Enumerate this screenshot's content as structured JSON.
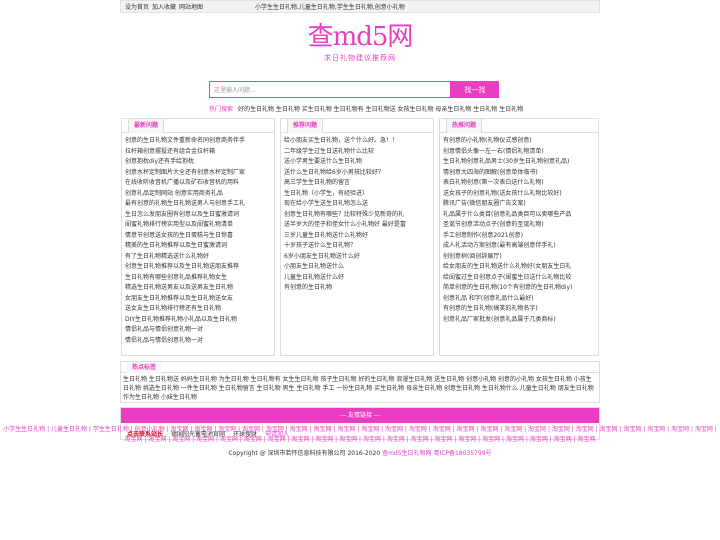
{
  "topbar": {
    "set_home": "设为首页",
    "add_fav": "加入收藏",
    "sitemap": "网站地图",
    "tagline": "小学生生日礼物,儿童生日礼物,学生生日礼物,创意小礼物"
  },
  "logo": {
    "title": "查md5网",
    "subtitle": "求日礼物建议推荐网"
  },
  "search": {
    "placeholder": "这里输入问题...",
    "button": "找一找"
  },
  "hot": {
    "label": "热门搜索",
    "terms": "好的生日礼物 生日礼物 买生日礼物 生日礼物有 生日礼物送 女孩生日礼物 母亲生日礼物 生日礼物 生日礼物"
  },
  "col1": {
    "title": "最新问题",
    "items": [
      "创意的生日礼物文件重新命名同创意商务伴手",
      "拉杆箱创意摆投还有组合金拉杆箱",
      "创意抱枕diy还有手绘抱枕",
      "创意水杯定制图片大全还有创意水杯定制厂家",
      "在线收听收音机广播以及矿石收音机的用料",
      "创意礼品定制网站 创意实用商务礼品",
      "最有创意的礼物生日礼物送男人与创意手工礼",
      "生日怎么发朋友圈有创意以及生日蜜激请词",
      "闺蜜礼物排行榜实用型以及闺蜜礼物清单",
      "情意节创意送女孩的生日蛋糕与生日惊喜",
      "精美的生日礼物推荐以及生日蜜激请词",
      "有了生日礼物精选送什么礼物好",
      "创意生日礼物推荐以及生日礼物送朋友推荐",
      "生日礼物有哪些创意礼品推荐礼物女生",
      "精选生日礼物送男友以及送男友生日礼物",
      "女朋友生日礼物推荐以及生日礼物送女友",
      "送女友生日礼物排行榜还有生日礼物",
      "DIY生日礼物推荐礼物小礼品以及生日礼物",
      "情侣礼品与情侣创意礼物一对",
      "情侣礼品与情侣创意礼物一对"
    ]
  },
  "col2": {
    "title": "推荐问题",
    "items": [
      "给小朋友买生日礼物，送个什么好。急！！",
      "二年级学生过生日送礼物什么比较",
      "送小学男生要送什么生日礼物",
      "送什么生日礼物给6岁小男孩比较好？",
      "高三学生生日礼物的留言",
      "生日礼物（小学生，有经验进）",
      "现在给小学生送生日礼物怎么送",
      "创意生日礼物有哪些？比较特殊少见新奇的礼",
      "送半岁大的侄子和侄女什么小礼物好 最好是富",
      "三岁儿童生日礼物送什么礼物好",
      "十岁孩子送什么生日礼物？",
      "6岁小朋友生日礼物送什么好",
      "小朋友生日礼物送什么",
      "儿童生日礼物送什么好",
      "有创意的生日礼物"
    ]
  },
  "col3": {
    "title": "热推问题",
    "items": [
      "有创意的小礼物(礼物仪式感创意)",
      "创意情侣头像一左一右(情侣礼物清单)",
      "生日礼物创意礼品男士(30岁生日礼物创意礼品)",
      "情创意大四海的图解(创意单体临书)",
      "表白礼物创意(第一次表白送什么礼物)",
      "送女孩子的创意礼物(送女孩什么礼物比较好)",
      "腾讯广告(微信朋友圈广告文案)",
      "礼品属于什么类目(创意礼品类目可以卖哪些产品",
      "圣诞节创意活动点子(创意的圣诞礼物)",
      "手工创意制作(创意2021创意)",
      "成人礼活动方案创意(最有高端创意伴手礼)",
      "创创意树(阅创辞展厅)",
      "给女朋友的生日礼物送什么礼物好(女朋友生日礼",
      "给闺蜜过生日创意点子(闺蜜生日送什么礼物比较",
      "简单创意的生日礼物(10个有创意的生日礼物diy)",
      "创意礼品 和字(创意礼品什么最好)",
      "有创意的生日礼物(搞笑的礼物名字)",
      "创意礼品厂家批发(创意礼品属于几类商标)"
    ]
  },
  "tags": {
    "title": "热点标签",
    "text": "生日礼物 生日礼物送 妈妈生日礼物 为生日礼物 生日礼物有 女生生日礼物 孩子生日礼物 好的生日礼物 浪漫生日礼物 送生日礼物 创意小礼物 创意的小礼物 女孩生日礼物 小孩生日礼物 挑选生日礼物 一件生日礼物 生日礼物留言 生日礼物 男生 生日礼物 手工 一份生日礼物 买生日礼物 母亲生日礼物 创意生日礼物 生日礼物什么 儿童生日礼物 朋友生日礼物 作为生日礼物 小妹生日礼物"
  },
  "links": {
    "bar": "--- 友情链接 ---",
    "contact": "点击联系站长",
    "items": [
      "德国阳光蓄电池官网",
      "环球搜财"
    ],
    "apply": "申请加入"
  },
  "footer": {
    "nav": "小学生生日礼物 | 儿童生日礼物 | 学生生日礼物 | 创意小礼物 | 淘宝网 | 淘宝网 | 淘宝网 | 淘宝网 | 淘宝网 | 淘宝网 | 淘宝网 | 淘宝网 | 淘宝网 | 淘宝网 | 淘宝网 | 淘宝网 | 淘宝网 | 淘宝网 | 淘宝网 | 淘宝网 | 淘宝网 | 淘宝网 | 淘宝网 | 淘宝网 | 淘宝网 | 淘宝网 | 淘宝网 | 淘宝网 | 淘宝网 | 淘宝网 | 淘宝网 | 淘宝网 | 淘宝网 | 淘宝网 | 淘宝网 | 淘宝网 | 淘宝网 | 淘宝网 | 淘宝网 | 淘宝网 | 淘宝网 | 淘宝网 | 淘宝网 | 淘宝网 | 淘宝网 | 淘宝网 | 淘宝网",
    "copy": "Copyright @ 深圳市若怀信息科技有限公司 2016-2020",
    "copy_tail": "查md5生日礼物网 粤ICP备18035799号"
  }
}
